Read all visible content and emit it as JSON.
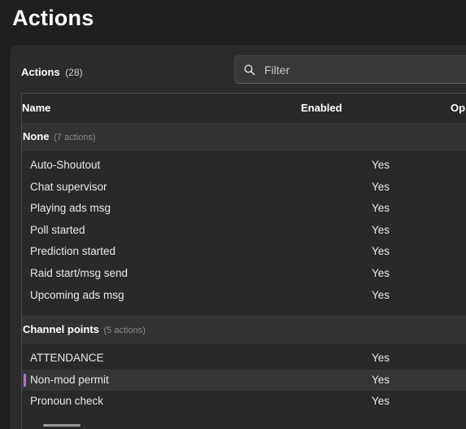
{
  "page": {
    "title": "Actions"
  },
  "panel": {
    "title": "Actions",
    "count": "(28)"
  },
  "filter": {
    "placeholder": "Filter",
    "value": ""
  },
  "table": {
    "columns": {
      "name": "Name",
      "enabled": "Enabled",
      "options": "Op"
    },
    "groups": [
      {
        "name": "None",
        "count": "(7 actions)",
        "rows": [
          {
            "name": "Auto-Shoutout",
            "enabled": "Yes"
          },
          {
            "name": "Chat supervisor",
            "enabled": "Yes"
          },
          {
            "name": "Playing ads msg",
            "enabled": "Yes"
          },
          {
            "name": "Poll started",
            "enabled": "Yes"
          },
          {
            "name": "Prediction started",
            "enabled": "Yes"
          },
          {
            "name": "Raid start/msg send",
            "enabled": "Yes"
          },
          {
            "name": "Upcoming ads msg",
            "enabled": "Yes"
          }
        ]
      },
      {
        "name": "Channel points",
        "count": "(5 actions)",
        "rows": [
          {
            "name": "ATTENDANCE",
            "enabled": "Yes"
          },
          {
            "name": "Non-mod permit",
            "enabled": "Yes",
            "selected": true
          },
          {
            "name": "Pronoun check",
            "enabled": "Yes"
          }
        ]
      }
    ]
  },
  "colors": {
    "background": "#1f1f1f",
    "panel": "#2b2b2b",
    "group_header": "#323232",
    "selection_indicator": "#b46fd1"
  },
  "icons": {
    "filter": "search-icon"
  }
}
